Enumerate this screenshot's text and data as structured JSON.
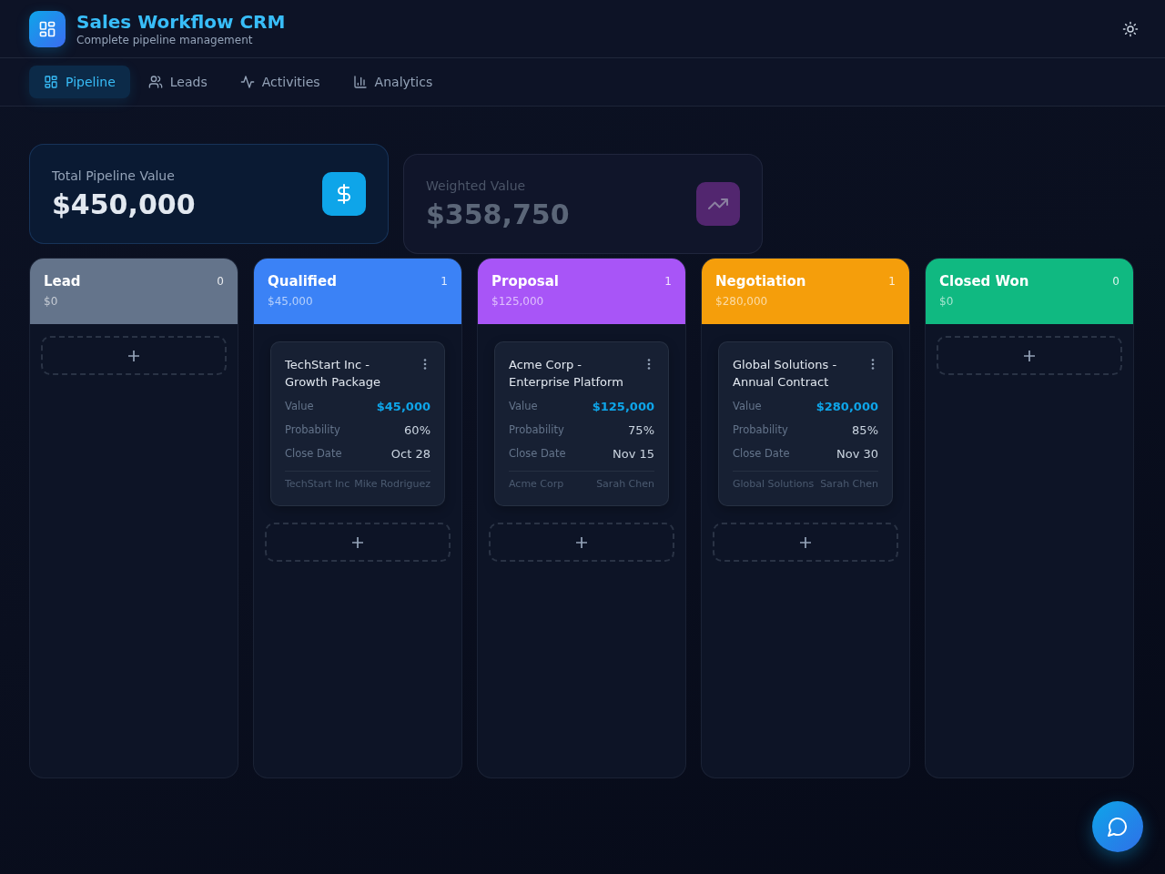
{
  "app": {
    "title": "Sales Workflow CRM",
    "subtitle": "Complete pipeline management"
  },
  "nav": [
    {
      "label": "Pipeline",
      "selected": true
    },
    {
      "label": "Leads",
      "selected": false
    },
    {
      "label": "Activities",
      "selected": false
    },
    {
      "label": "Analytics",
      "selected": false
    }
  ],
  "stats": [
    {
      "label": "Total Pipeline Value",
      "value": "$450,000",
      "color": "#0ea5e9"
    },
    {
      "label": "Weighted Value",
      "value": "$358,750",
      "color": "#52266f"
    }
  ],
  "columns": [
    {
      "name": "Lead",
      "count": "0",
      "amount": "$0",
      "color": "#64748b"
    },
    {
      "name": "Qualified",
      "count": "1",
      "amount": "$45,000",
      "color": "#3b82f6",
      "deals": [
        {
          "title": "TechStart Inc - Growth Package",
          "fields": [
            {
              "label": "Value",
              "value": "$45,000",
              "kind": "money"
            },
            {
              "label": "Probability",
              "value": "60%",
              "kind": "plain"
            },
            {
              "label": "Close Date",
              "value": "Oct 28",
              "kind": "plain"
            }
          ],
          "company": "TechStart Inc",
          "owner": "Mike Rodriguez"
        }
      ]
    },
    {
      "name": "Proposal",
      "count": "1",
      "amount": "$125,000",
      "color": "#a855f7",
      "deals": [
        {
          "title": "Acme Corp - Enterprise Platform",
          "fields": [
            {
              "label": "Value",
              "value": "$125,000",
              "kind": "money"
            },
            {
              "label": "Probability",
              "value": "75%",
              "kind": "plain"
            },
            {
              "label": "Close Date",
              "value": "Nov 15",
              "kind": "plain"
            }
          ],
          "company": "Acme Corp",
          "owner": "Sarah Chen"
        }
      ]
    },
    {
      "name": "Negotiation",
      "count": "1",
      "amount": "$280,000",
      "color": "#f59e0b",
      "deals": [
        {
          "title": "Global Solutions - Annual Contract",
          "fields": [
            {
              "label": "Value",
              "value": "$280,000",
              "kind": "money"
            },
            {
              "label": "Probability",
              "value": "85%",
              "kind": "plain"
            },
            {
              "label": "Close Date",
              "value": "Nov 30",
              "kind": "plain"
            }
          ],
          "company": "Global Solutions",
          "owner": "Sarah Chen"
        }
      ]
    },
    {
      "name": "Closed Won",
      "count": "0",
      "amount": "$0",
      "color": "#10b981"
    }
  ]
}
